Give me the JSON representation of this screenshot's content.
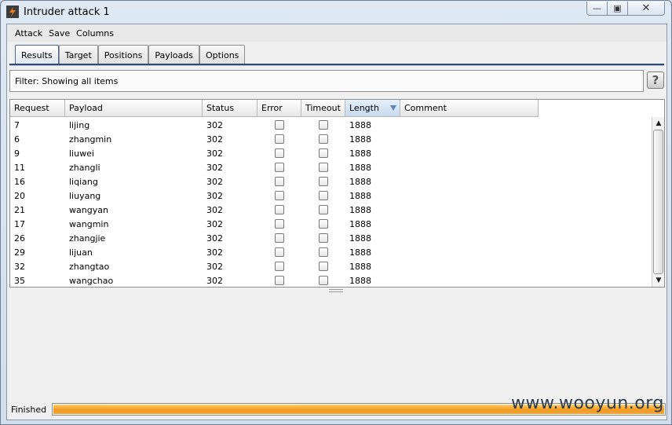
{
  "window": {
    "title": "Intruder attack 1"
  },
  "menu": {
    "items": [
      "Attack",
      "Save",
      "Columns"
    ]
  },
  "tabs": [
    {
      "label": "Results",
      "active": true
    },
    {
      "label": "Target",
      "active": false
    },
    {
      "label": "Positions",
      "active": false
    },
    {
      "label": "Payloads",
      "active": false
    },
    {
      "label": "Options",
      "active": false
    }
  ],
  "filter": {
    "text": "Filter:  Showing all items"
  },
  "help": {
    "label": "?"
  },
  "table": {
    "columns": [
      "Request",
      "Payload",
      "Status",
      "Error",
      "Timeout",
      "Length",
      "Comment"
    ],
    "sorted_column": "Length",
    "rows": [
      {
        "request": "7",
        "payload": "lijing",
        "status": "302",
        "error": false,
        "timeout": false,
        "length": "1888",
        "comment": ""
      },
      {
        "request": "6",
        "payload": "zhangmin",
        "status": "302",
        "error": false,
        "timeout": false,
        "length": "1888",
        "comment": ""
      },
      {
        "request": "9",
        "payload": "liuwei",
        "status": "302",
        "error": false,
        "timeout": false,
        "length": "1888",
        "comment": ""
      },
      {
        "request": "11",
        "payload": "zhangli",
        "status": "302",
        "error": false,
        "timeout": false,
        "length": "1888",
        "comment": ""
      },
      {
        "request": "16",
        "payload": "liqiang",
        "status": "302",
        "error": false,
        "timeout": false,
        "length": "1888",
        "comment": ""
      },
      {
        "request": "20",
        "payload": "liuyang",
        "status": "302",
        "error": false,
        "timeout": false,
        "length": "1888",
        "comment": ""
      },
      {
        "request": "21",
        "payload": "wangyan",
        "status": "302",
        "error": false,
        "timeout": false,
        "length": "1888",
        "comment": ""
      },
      {
        "request": "17",
        "payload": "wangmin",
        "status": "302",
        "error": false,
        "timeout": false,
        "length": "1888",
        "comment": ""
      },
      {
        "request": "26",
        "payload": "zhangjie",
        "status": "302",
        "error": false,
        "timeout": false,
        "length": "1888",
        "comment": ""
      },
      {
        "request": "29",
        "payload": "lijuan",
        "status": "302",
        "error": false,
        "timeout": false,
        "length": "1888",
        "comment": ""
      },
      {
        "request": "32",
        "payload": "zhangtao",
        "status": "302",
        "error": false,
        "timeout": false,
        "length": "1888",
        "comment": ""
      },
      {
        "request": "35",
        "payload": "wangchao",
        "status": "302",
        "error": false,
        "timeout": false,
        "length": "1888",
        "comment": ""
      }
    ]
  },
  "status": {
    "label": "Finished",
    "progress_percent": 100
  },
  "watermark": {
    "text": "www.wooyun.org"
  },
  "colors": {
    "accent": "#2b4a74",
    "progress": "#f39a1f"
  }
}
